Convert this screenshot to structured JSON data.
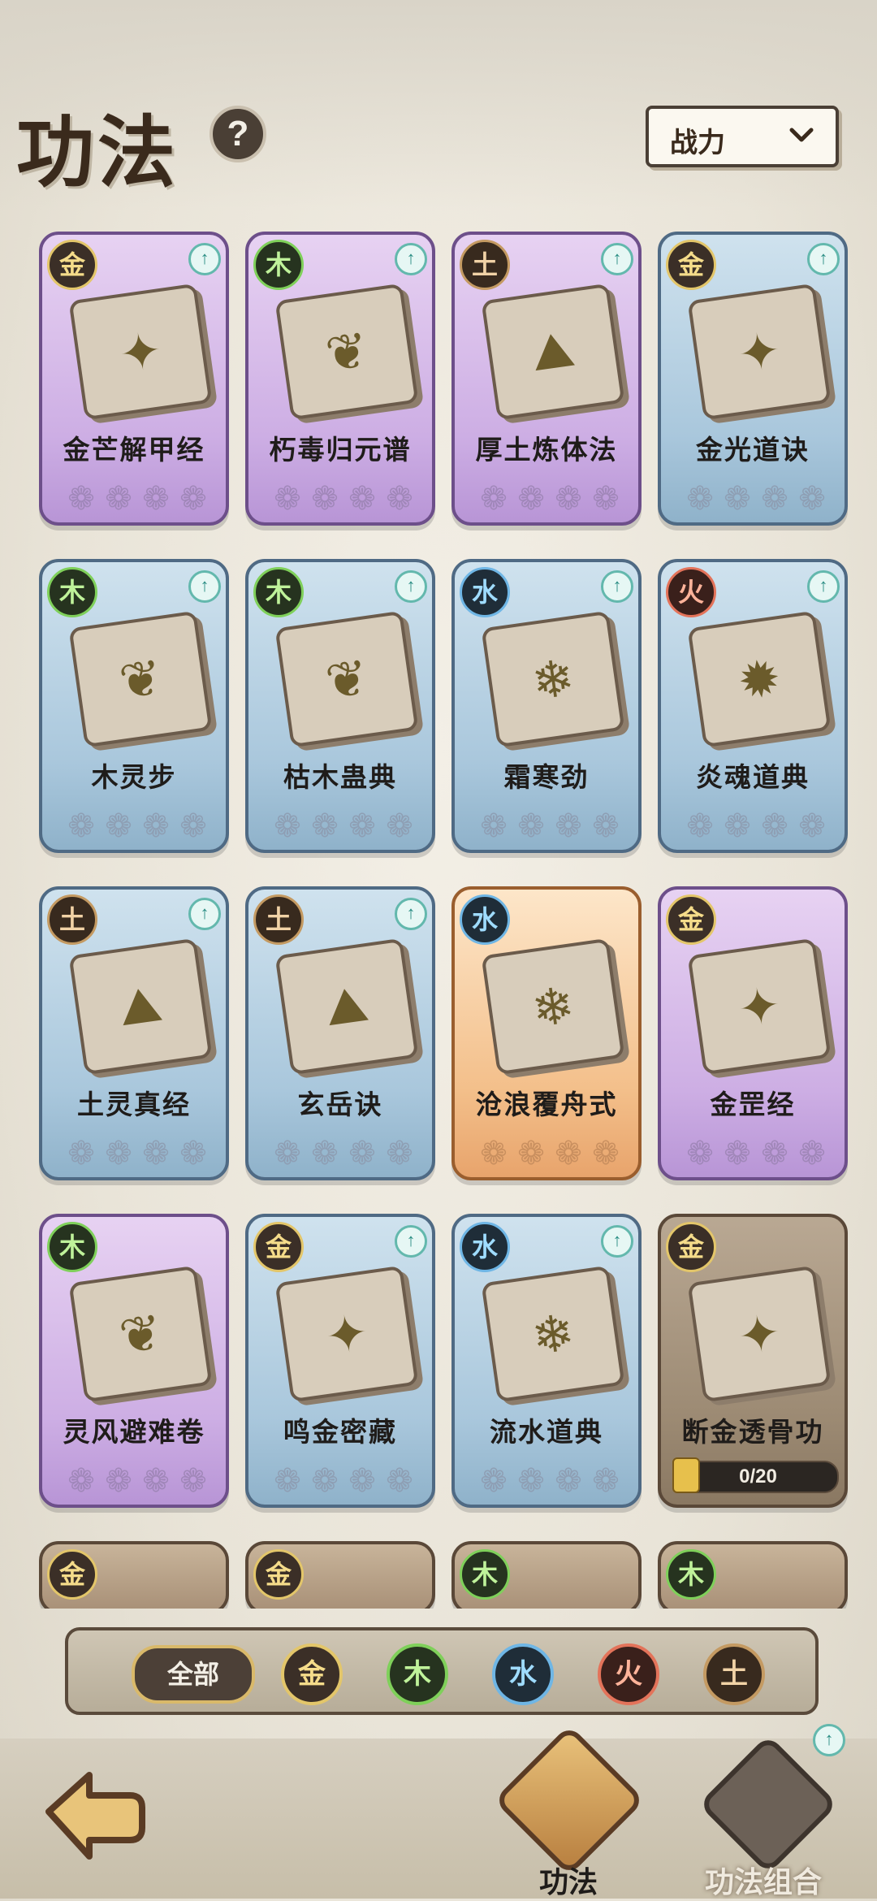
{
  "header": {
    "title": "功法",
    "help": "?",
    "sort_label": "战力"
  },
  "cards": [
    {
      "name": "金芒解甲经",
      "element": "金",
      "rarity": "purple"
    },
    {
      "name": "朽毒归元谱",
      "element": "木",
      "rarity": "purple"
    },
    {
      "name": "厚土炼体法",
      "element": "土",
      "rarity": "purple"
    },
    {
      "name": "金光道诀",
      "element": "金",
      "rarity": "blue"
    },
    {
      "name": "木灵步",
      "element": "木",
      "rarity": "blue"
    },
    {
      "name": "枯木蛊典",
      "element": "木",
      "rarity": "blue"
    },
    {
      "name": "霜寒劲",
      "element": "水",
      "rarity": "blue"
    },
    {
      "name": "炎魂道典",
      "element": "火",
      "rarity": "blue"
    },
    {
      "name": "土灵真经",
      "element": "土",
      "rarity": "blue"
    },
    {
      "name": "玄岳诀",
      "element": "土",
      "rarity": "blue"
    },
    {
      "name": "沧浪覆舟式",
      "element": "水",
      "rarity": "orange"
    },
    {
      "name": "金罡经",
      "element": "金",
      "rarity": "purple"
    },
    {
      "name": "灵风避难卷",
      "element": "木",
      "rarity": "purple"
    },
    {
      "name": "鸣金密藏",
      "element": "金",
      "rarity": "blue"
    },
    {
      "name": "流水道典",
      "element": "水",
      "rarity": "blue"
    },
    {
      "name": "断金透骨功",
      "element": "金",
      "rarity": "locked",
      "progress": "0/20"
    }
  ],
  "stub_elements": [
    "金",
    "金",
    "木",
    "木"
  ],
  "filters": {
    "all": "全部",
    "elements": [
      "金",
      "木",
      "水",
      "火",
      "土"
    ]
  },
  "bottom": {
    "tab_main": "功法",
    "tab_combo": "功法组合"
  },
  "colors": {
    "jin": "#f5dc8a",
    "mu": "#bff29a",
    "shui": "#9fdcff",
    "huo": "#ffb39a",
    "tu": "#f1d2a6"
  }
}
